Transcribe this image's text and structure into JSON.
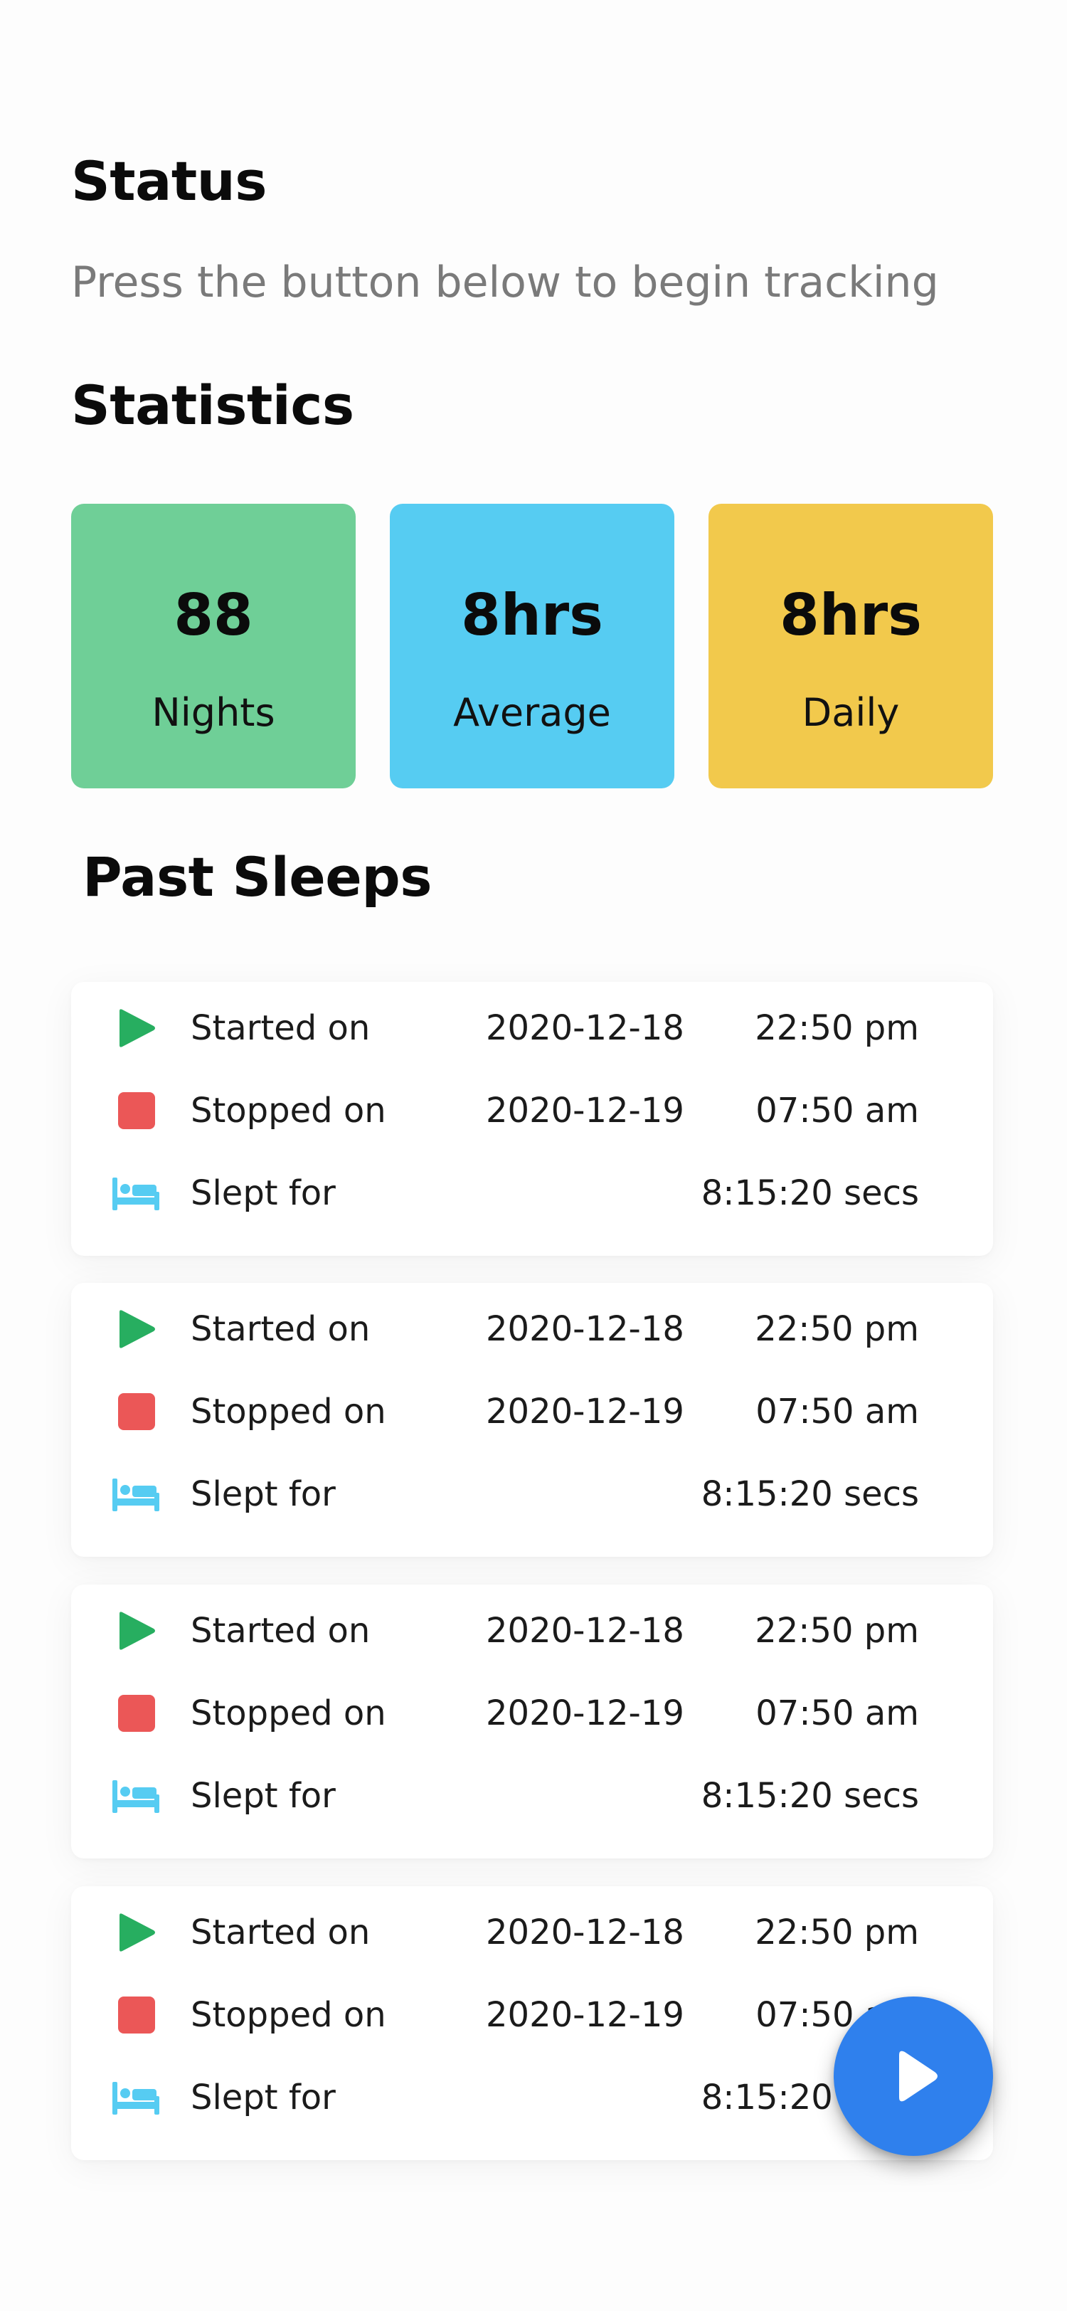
{
  "colors": {
    "green": "#6fcf97",
    "blue": "#56ccf2",
    "yellow": "#f2c94c",
    "play": "#27ae60",
    "stop": "#eb5757",
    "bed": "#56ccf2",
    "fab": "#2f80ed"
  },
  "status": {
    "title": "Status",
    "message": "Press the button below to begin tracking"
  },
  "statistics": {
    "title": "Statistics",
    "cards": [
      {
        "value": "88",
        "label": "Nights"
      },
      {
        "value": "8hrs",
        "label": "Average"
      },
      {
        "value": "8hrs",
        "label": "Daily"
      }
    ]
  },
  "past_sleeps": {
    "title": "Past Sleeps",
    "items": [
      {
        "started_label": "Started on",
        "started_date": "2020-12-18",
        "started_time": "22:50 pm",
        "stopped_label": "Stopped on",
        "stopped_date": "2020-12-19",
        "stopped_time": "07:50 am",
        "slept_label": "Slept for",
        "slept_value": "8:15:20 secs"
      },
      {
        "started_label": "Started on",
        "started_date": "2020-12-18",
        "started_time": "22:50 pm",
        "stopped_label": "Stopped on",
        "stopped_date": "2020-12-19",
        "stopped_time": "07:50 am",
        "slept_label": "Slept for",
        "slept_value": "8:15:20 secs"
      },
      {
        "started_label": "Started on",
        "started_date": "2020-12-18",
        "started_time": "22:50 pm",
        "stopped_label": "Stopped on",
        "stopped_date": "2020-12-19",
        "stopped_time": "07:50 am",
        "slept_label": "Slept for",
        "slept_value": "8:15:20 secs"
      },
      {
        "started_label": "Started on",
        "started_date": "2020-12-18",
        "started_time": "22:50 pm",
        "stopped_label": "Stopped on",
        "stopped_date": "2020-12-19",
        "stopped_time": "07:50 am",
        "slept_label": "Slept for",
        "slept_value": "8:15:20 secs"
      }
    ]
  },
  "fab": {
    "icon": "play-icon"
  }
}
